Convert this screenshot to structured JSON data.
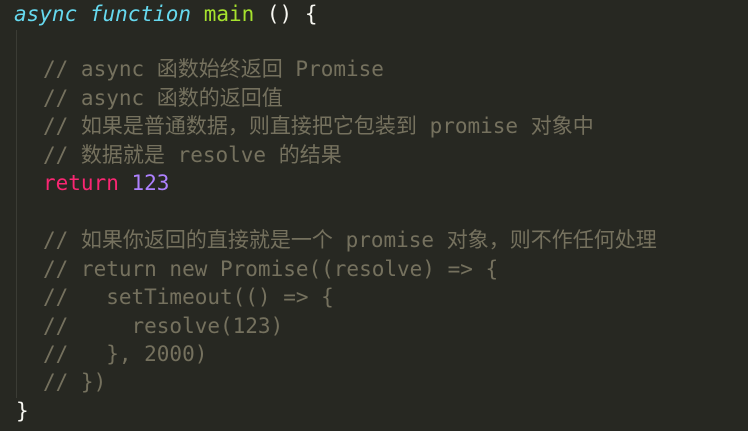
{
  "code": {
    "line1": {
      "async_kw": "async",
      "function_kw": "function",
      "fn_name": "main",
      "rest": " () {"
    },
    "comments": [
      "// async 函数始终返回 Promise",
      "// async 函数的返回值",
      "// 如果是普通数据，则直接把它包装到 promise 对象中",
      "// 数据就是 resolve 的结果"
    ],
    "return_line": {
      "keyword": "return",
      "value": "123"
    },
    "commented_block": [
      "// 如果你返回的直接就是一个 promise 对象，则不作任何处理",
      "// return new Promise((resolve) => {",
      "//   setTimeout(() => {",
      "//     resolve(123)",
      "//   }, 2000)",
      "// })"
    ],
    "closing_brace": "}"
  },
  "colors": {
    "background": "#272822",
    "comment": "#75715e",
    "keyword_italic": "#66d9ef",
    "function_name": "#a6e22e",
    "keyword": "#f92672",
    "number": "#ae81ff",
    "text": "#f8f8f2"
  }
}
